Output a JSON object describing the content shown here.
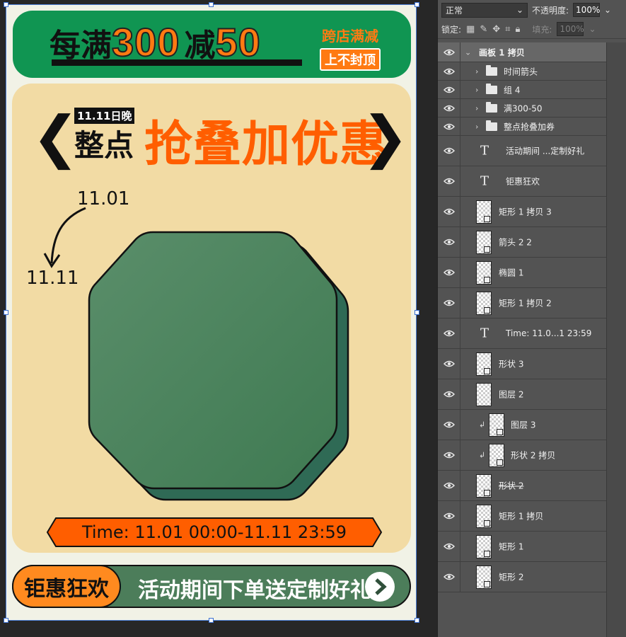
{
  "canvas": {
    "banner": {
      "prefix": "每满",
      "num1": "300",
      "mid": "减",
      "num2": "50",
      "side_top": "跨店满减",
      "side_bottom": "上不封顶"
    },
    "headline": {
      "tag_small": "11.11日晚",
      "tag_big": "整点",
      "title": "抢叠加优惠",
      "left_brace": "❮",
      "right_brace": "❯"
    },
    "dates": {
      "from": "11.01",
      "to": "11.11"
    },
    "time_bar": "Time: 11.01  00:00-11.11  23:59",
    "bottom": {
      "left_label": "钜惠狂欢",
      "right_label": "活动期间下单送定制好礼"
    },
    "colors": {
      "green": "#109552",
      "orange": "#ff5e00",
      "cream": "#f2dba4",
      "dark_green": "#4c7d5a"
    }
  },
  "layers_panel": {
    "blend_mode": "正常",
    "opacity_label": "不透明度:",
    "opacity_value": "100%",
    "lock_label": "锁定:",
    "fill_label": "填充:",
    "fill_value": "100%",
    "layers": [
      {
        "name": "画板 1 拷贝",
        "kind": "root"
      },
      {
        "name": "时间箭头",
        "kind": "group"
      },
      {
        "name": "组 4",
        "kind": "group"
      },
      {
        "name": "满300-50",
        "kind": "group"
      },
      {
        "name": "整点抢叠加券",
        "kind": "group"
      },
      {
        "name": "活动期间 ...定制好礼",
        "kind": "text"
      },
      {
        "name": "钜惠狂欢",
        "kind": "text"
      },
      {
        "name": "矩形 1 拷贝 3",
        "kind": "pixel"
      },
      {
        "name": "箭头 2 2",
        "kind": "pixel"
      },
      {
        "name": "椭圆 1",
        "kind": "pixel"
      },
      {
        "name": "矩形 1 拷贝 2",
        "kind": "pixel"
      },
      {
        "name": "Time: 11.0...1  23:59",
        "kind": "text"
      },
      {
        "name": "形状 3",
        "kind": "pixel"
      },
      {
        "name": "图层 2",
        "kind": "plain"
      },
      {
        "name": "图层 3",
        "kind": "clip"
      },
      {
        "name": "形状 2 拷贝",
        "kind": "clip"
      },
      {
        "name": "形状 2",
        "kind": "strike"
      },
      {
        "name": "矩形 1 拷贝",
        "kind": "pixel"
      },
      {
        "name": "矩形 1",
        "kind": "pixel"
      },
      {
        "name": "矩形 2",
        "kind": "pixel"
      }
    ]
  }
}
